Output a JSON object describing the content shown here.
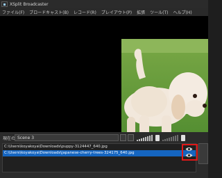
{
  "window": {
    "title": "XSplit Broadcaster"
  },
  "menu": [
    "ファイル(F)",
    "ブロードキャスト(B)",
    "レコード(R)",
    "プレイアウト(P)",
    "拡張",
    "ツール(T)",
    "ヘルプ(H)"
  ],
  "scene": {
    "label": "現在の",
    "value": "Scene 3"
  },
  "sources": [
    {
      "path": "C:\\Users\\koyakoya\\Downloads\\puppy-3124447_640.jpg",
      "selected": false
    },
    {
      "path": "C:\\Users\\koyakoya\\Downloads\\japanese-cherry-trees-324175_640.jpg",
      "selected": true
    }
  ],
  "icons": {
    "visibility": "eye-icon"
  },
  "colors": {
    "selection": "#1565c0",
    "highlight": "#e01818"
  }
}
